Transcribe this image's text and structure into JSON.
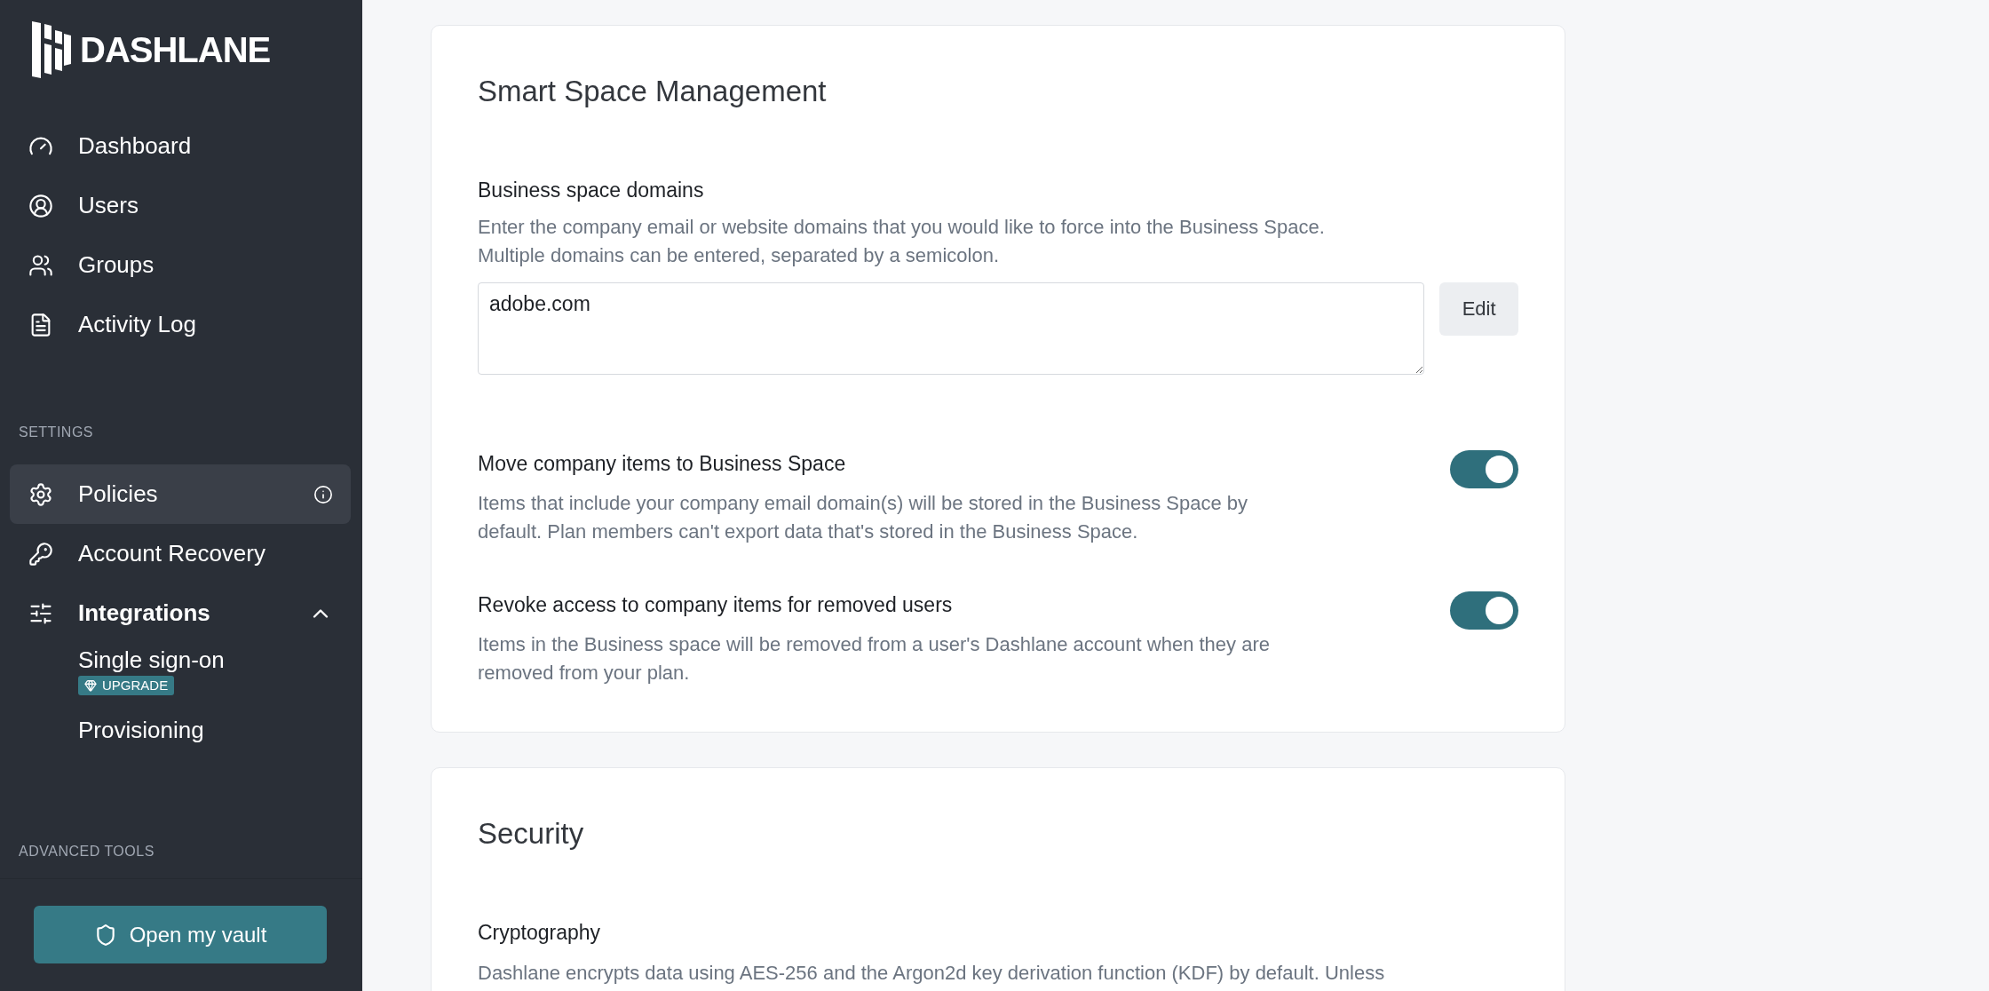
{
  "sidebar": {
    "logo": "DASHLANE",
    "nav": [
      {
        "label": "Dashboard",
        "selected": false
      },
      {
        "label": "Users",
        "selected": false
      },
      {
        "label": "Groups",
        "selected": false
      },
      {
        "label": "Activity Log",
        "selected": false
      }
    ],
    "settings": {
      "label": "SETTINGS",
      "items": [
        {
          "label": "Policies",
          "selected": true,
          "info": true
        },
        {
          "label": "Account Recovery",
          "selected": false,
          "info": false
        },
        {
          "label": "Integrations",
          "selected": false,
          "info": false,
          "expanded": true,
          "children": [
            {
              "label": "Single sign-on",
              "badge": "UPGRADE",
              "selected": false
            },
            {
              "label": "Provisioning",
              "selected": false
            }
          ]
        }
      ]
    },
    "advanced": {
      "label": "ADVANCED TOOLS"
    },
    "vault_button": "Open my vault"
  },
  "cards": [
    {
      "title": "Smart Space Management",
      "sections": [
        {
          "kind": "textarea",
          "title": "Business space domains",
          "description": "Enter the company email or website domains that you would like to force into the Business Space.\nMultiple domains can be entered, separated by a semicolon.",
          "value": "adobe.com",
          "button": "Edit"
        },
        {
          "kind": "toggle",
          "title": "Move company items to Business Space",
          "description": "Items that include your company email domain(s) will be stored in the Business Space by default. Plan members can't export data that's stored in the Business Space.",
          "on": true
        },
        {
          "kind": "toggle",
          "title": "Revoke access to company items for removed users",
          "description": "Items in the Business space will be removed from a user's Dashlane account when they are removed from your plan.",
          "on": true
        }
      ]
    },
    {
      "title": "Security",
      "sections": [
        {
          "kind": "text",
          "title": "Cryptography",
          "description": "Dashlane encrypts data using AES-256 and the Argon2d key derivation function (KDF) by default. Unless"
        }
      ]
    }
  ]
}
